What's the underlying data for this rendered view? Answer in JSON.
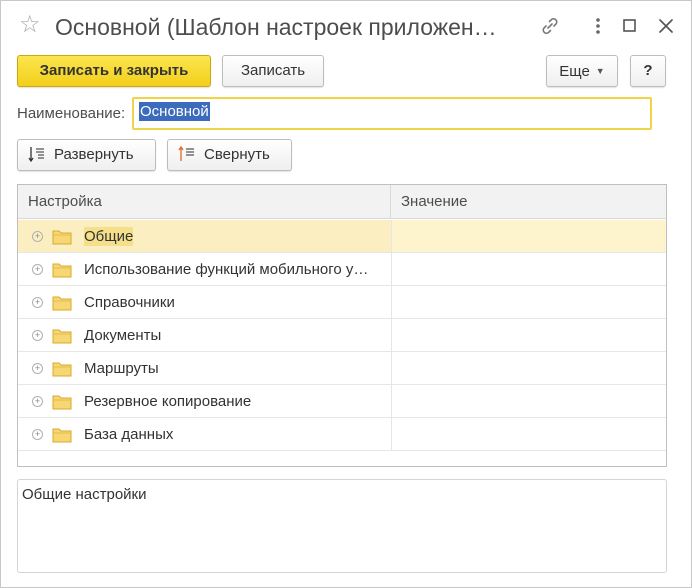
{
  "window": {
    "title": "Основной (Шаблон настроек приложен…",
    "star_icon": "star-icon",
    "link_icon": "link-icon",
    "menu_icon": "more-vertical-icon",
    "maximize_icon": "maximize-icon",
    "close_icon": "close-icon"
  },
  "toolbar": {
    "save_close_label": "Записать и закрыть",
    "save_label": "Записать",
    "more_label": "Еще",
    "help_label": "?"
  },
  "name_field": {
    "label": "Наименование:",
    "value": "Основной"
  },
  "tree_actions": {
    "expand_label": "Развернуть",
    "collapse_label": "Свернуть"
  },
  "tree": {
    "columns": [
      "Настройка",
      "Значение"
    ],
    "rows": [
      {
        "label": "Общие",
        "value": ""
      },
      {
        "label": "Использование функций мобильного у…",
        "value": ""
      },
      {
        "label": "Справочники",
        "value": ""
      },
      {
        "label": "Документы",
        "value": ""
      },
      {
        "label": "Маршруты",
        "value": ""
      },
      {
        "label": "Резервное копирование",
        "value": ""
      },
      {
        "label": "База данных",
        "value": ""
      }
    ],
    "selected_index": 0
  },
  "description": {
    "text": "Общие настройки"
  },
  "colors": {
    "primary_button": "#f2cf1a",
    "selection_row": "#fbefc2",
    "input_focus_border": "#f0d448",
    "text_selection": "#3c6bbd",
    "folder": "#f2c94c"
  }
}
